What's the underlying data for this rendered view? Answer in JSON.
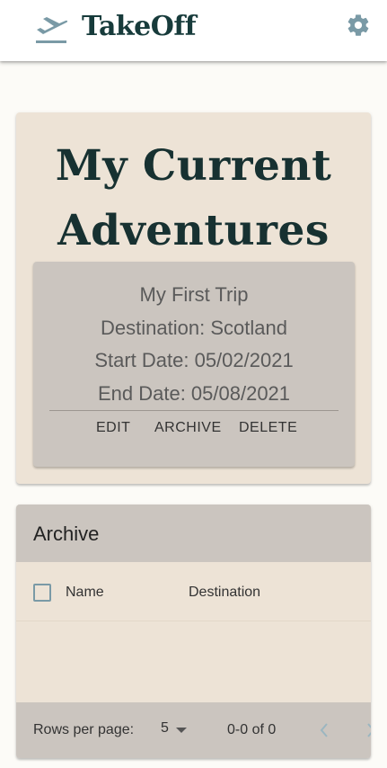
{
  "app": {
    "brand": "TakeOff",
    "logo_icon": "plane-takeoff-icon",
    "settings_icon": "gear-icon",
    "accent": "#173b3b",
    "icon_color": "#7a9aa6"
  },
  "current": {
    "title_line1": "My Current",
    "title_line2": "Adventures",
    "trips": [
      {
        "name": "My First Trip",
        "destination": "Destination: Scotland",
        "start": "Start Date: 05/02/2021",
        "end": "End Date: 05/08/2021",
        "actions": [
          "EDIT",
          "ARCHIVE",
          "DELETE"
        ]
      }
    ]
  },
  "archive": {
    "title": "Archive",
    "columns": [
      "Name",
      "Destination"
    ],
    "rows": [],
    "pagination": {
      "rows_per_page_label": "Rows per page:",
      "rows_per_page": "5",
      "range": "0-0 of 0"
    }
  }
}
